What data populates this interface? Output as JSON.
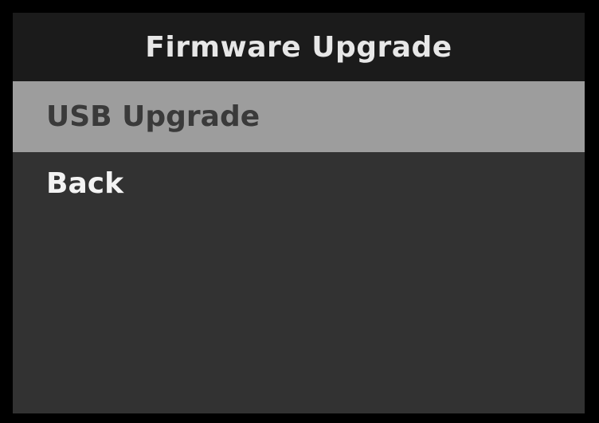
{
  "header": {
    "title": "Firmware Upgrade"
  },
  "menu": {
    "items": [
      {
        "label": "USB Upgrade",
        "selected": true
      },
      {
        "label": "Back",
        "selected": false
      }
    ]
  },
  "colors": {
    "frame": "#000000",
    "screen_background": "#323232",
    "title_bar": "#1b1b1b",
    "selected_item_background": "#9d9d9d",
    "selected_item_text": "#3a3a3a",
    "item_text": "#f3f3f3"
  }
}
